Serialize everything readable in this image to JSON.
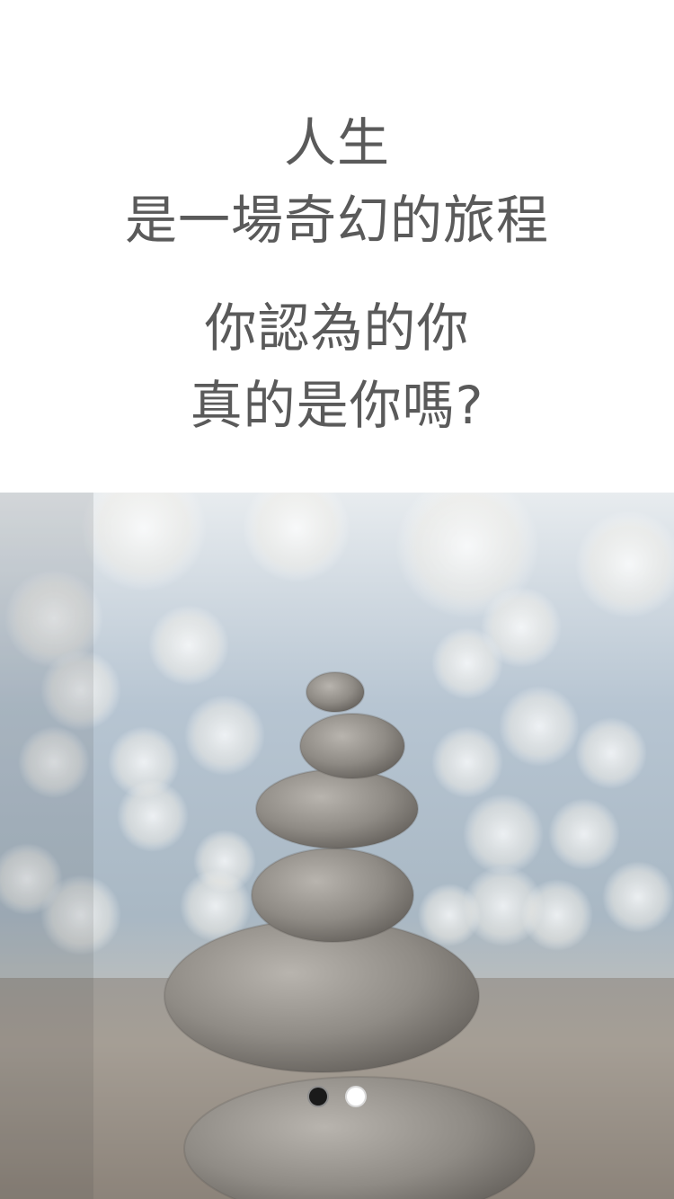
{
  "intro": {
    "line1": "人生",
    "line2": "是一場奇幻的旅程",
    "line3": "你認為的你",
    "line4": "真的是你嗎?"
  },
  "hero": {
    "image_icon": "stacked-stones-bokeh-image"
  },
  "pager": {
    "total": 2,
    "current": 1,
    "colors": {
      "active": "#1a1a1a",
      "inactive": "#ffffff"
    }
  },
  "colors": {
    "text": "#5a5a5a",
    "background": "#ffffff"
  }
}
